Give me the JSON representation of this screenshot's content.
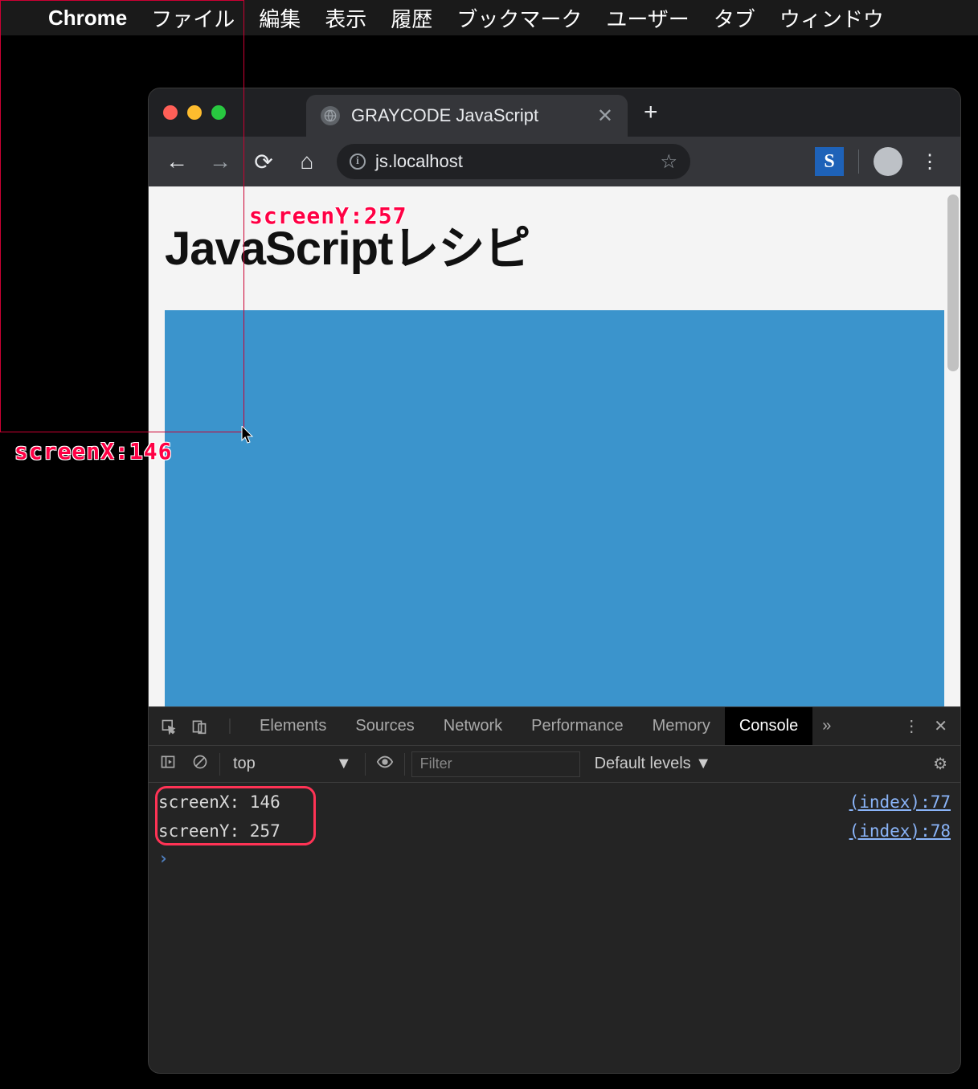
{
  "menubar": {
    "appname": "Chrome",
    "items": [
      "ファイル",
      "編集",
      "表示",
      "履歴",
      "ブックマーク",
      "ユーザー",
      "タブ",
      "ウィンドウ"
    ]
  },
  "browser": {
    "tab_title": "GRAYCODE JavaScript",
    "url": "js.localhost",
    "extension_letter": "S"
  },
  "page": {
    "heading": "JavaScriptレシピ"
  },
  "devtools": {
    "tabs": [
      "Elements",
      "Sources",
      "Network",
      "Performance",
      "Memory",
      "Console"
    ],
    "active_tab": "Console",
    "context": "top",
    "filter_placeholder": "Filter",
    "levels": "Default levels ▼",
    "console": [
      {
        "msg": "screenX: 146",
        "src": "(index):77"
      },
      {
        "msg": "screenY: 257",
        "src": "(index):78"
      }
    ]
  },
  "annotations": {
    "screenX_label": "screenX:146",
    "screenY_label": "screenY:257",
    "screenX_value": 146,
    "screenY_value": 257
  }
}
